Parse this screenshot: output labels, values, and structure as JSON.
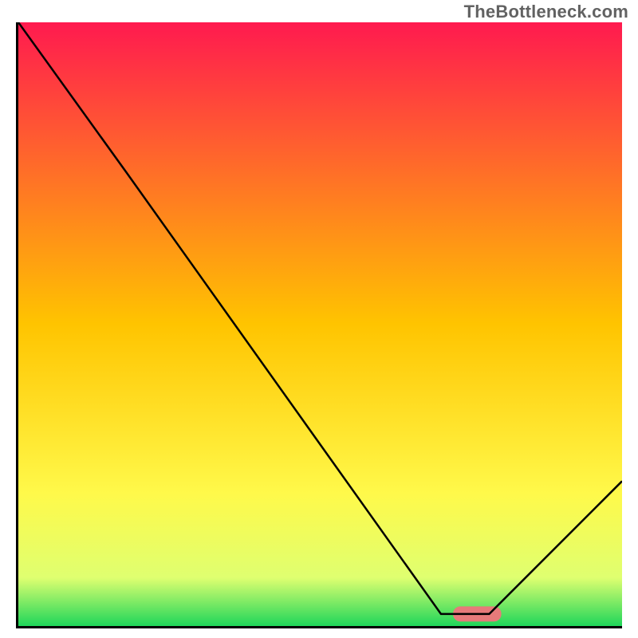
{
  "watermark": "TheBottleneck.com",
  "chart_data": {
    "type": "line",
    "title": "",
    "xlabel": "",
    "ylabel": "",
    "xlim": [
      0,
      100
    ],
    "ylim": [
      0,
      100
    ],
    "grid": false,
    "legend": false,
    "background": "red-yellow-green vertical gradient",
    "series": [
      {
        "name": "curve",
        "stroke": "#000000",
        "x": [
          0,
          18,
          70,
          78,
          100
        ],
        "y": [
          100,
          75,
          2,
          2,
          24
        ]
      }
    ],
    "marker": {
      "name": "optimal-zone",
      "shape": "rounded-bar",
      "fill": "#e77a7a",
      "x": [
        72,
        80
      ],
      "y": 2,
      "height": 2.5
    },
    "gradient_stops": [
      {
        "offset": 0.0,
        "color": "#ff1a4f"
      },
      {
        "offset": 0.5,
        "color": "#ffc400"
      },
      {
        "offset": 0.78,
        "color": "#fff94a"
      },
      {
        "offset": 0.92,
        "color": "#dfff70"
      },
      {
        "offset": 1.0,
        "color": "#1fd65a"
      }
    ]
  }
}
